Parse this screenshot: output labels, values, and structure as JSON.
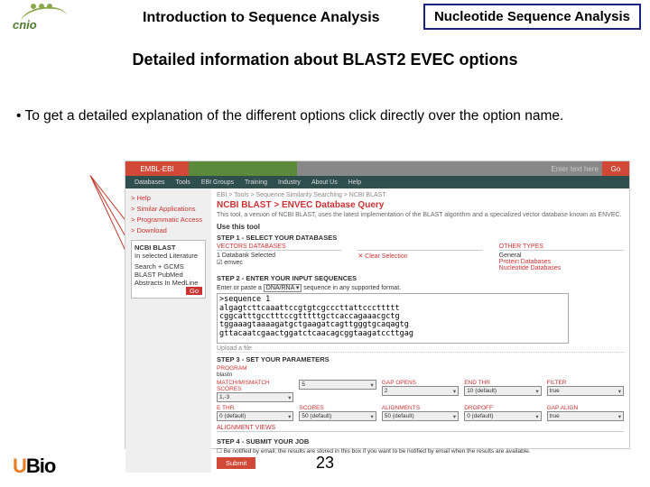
{
  "header": {
    "logo_text": "cnio",
    "title": "Introduction to Sequence Analysis",
    "tag": "Nucleotide Sequence Analysis"
  },
  "slide_title": "Detailed information about BLAST2 EVEC options",
  "bullet_text": "• To get a detailed explanation of the different options click directly over the option name.",
  "embed": {
    "tabs": {
      "t1": "EMBL-EBI",
      "t2": "",
      "t3": "",
      "search_ph": "Enter text here",
      "go": "Go"
    },
    "nav": [
      "Databases",
      "Tools",
      "EBI Groups",
      "Training",
      "Industry",
      "About Us",
      "Help"
    ],
    "sidebar": {
      "help": "> Help",
      "similar": "> Similar Applications",
      "prog": "> Programmatic Access",
      "dl": "> Download",
      "box_h": "NCBI BLAST",
      "box1": "In selected Literature",
      "s1": "Search + GCMS",
      "s2": "BLAST PubMed",
      "s3": "Abstracts In MedLine",
      "go": "Go"
    },
    "breadcrumb": "EBI > Tools > Sequence Similarity Searching > NCBI BLAST",
    "h1": "NCBI BLAST > ENVEC Database Query",
    "desc": "This tool, a version of NCBI BLAST, uses the latest implementation of the BLAST algorithm and a specialized vector database known as ENVEC.",
    "use": "Use this tool",
    "step1": "STEP 1 - Select your databases",
    "db": {
      "h1": "VECTORS DATABASES",
      "h2": "",
      "h3": "OTHER TYPES",
      "sel": "1 Databank Selected",
      "clear": "✕ Clear Selection",
      "chk": "emvec",
      "ot1": "General",
      "ot2": "Protein Databases",
      "ot3": "Nucleotide Databases"
    },
    "step2": "STEP 2 - Enter your input sequences",
    "radio": {
      "label": "Enter or paste a ",
      "type": "DNA/RNA ▾",
      "rest": " sequence in any supported format."
    },
    "seq": ">sequence 1\nalgagtcttcaaattccgtgtcgcccttattcccttttt\ncggcatttgcctttccgtttttgctcaccagaaacgctg\ntggaaagtaaaagatgctgaagatcagttgggtgcaqagtg\ngttacaatcgaactggatctcaacagcggtaagatccttgag",
    "upload": "Upload a file",
    "step3": "STEP 3 - Set your parameters",
    "params": {
      "h": "PROGRAM",
      "prog": "blastn",
      "r1": [
        "MATCH/MISMATCH SCORES",
        "",
        "GAP OPENS",
        "END THR",
        "FILTER"
      ],
      "v1": [
        "1,-3",
        "5",
        "2",
        "10 (default)",
        "true"
      ],
      "r2": [
        "E THR",
        "SCORES",
        "ALIGNMENTS",
        "DROPOFF",
        "GAP ALIGN"
      ],
      "v2": [
        "0 (default)",
        "50 (default)",
        "50 (default)",
        "0 (default)",
        "true"
      ]
    },
    "align": "ALIGNMENT VIEWS",
    "step4": "STEP 4 - Submit your job",
    "notify": "Be notified by email; the results are stored in this box if you want to be notified by email when the results are available.",
    "submit": "Submit"
  },
  "page_number": "23",
  "footer": {
    "u": "U",
    "b": "Bio"
  }
}
